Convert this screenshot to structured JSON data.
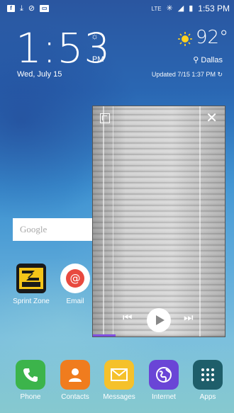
{
  "status_bar": {
    "time": "1:53 PM",
    "network": "LTE",
    "left_icons": [
      "facebook-icon",
      "download-icon",
      "check-icon",
      "voicemail-icon"
    ]
  },
  "clock": {
    "time": "1:53",
    "ampm": "PM",
    "date": "Wed, July 15"
  },
  "weather": {
    "temperature": "92°",
    "city": "Dallas",
    "updated": "Updated 7/15 1:37 PM"
  },
  "search": {
    "placeholder": "Google"
  },
  "home_apps": [
    {
      "label": "Sprint Zone",
      "icon": "sprint-zone-icon",
      "color": "#f5c518"
    },
    {
      "label": "Email",
      "icon": "email-icon",
      "color": "#e8493f"
    }
  ],
  "video_popup": {
    "controls": [
      "previous-icon",
      "play-icon",
      "next-icon"
    ],
    "progress_fraction": 0.17,
    "accent": "#7f4fe0"
  },
  "dock": [
    {
      "label": "Phone",
      "icon": "phone-icon",
      "color": "#3cb44b"
    },
    {
      "label": "Contacts",
      "icon": "contacts-icon",
      "color": "#f07c1e"
    },
    {
      "label": "Messages",
      "icon": "messages-icon",
      "color": "#f5c12b"
    },
    {
      "label": "Internet",
      "icon": "internet-icon",
      "color": "#6a45d6"
    },
    {
      "label": "Apps",
      "icon": "apps-grid-icon",
      "color": "#1e5e6a"
    }
  ]
}
